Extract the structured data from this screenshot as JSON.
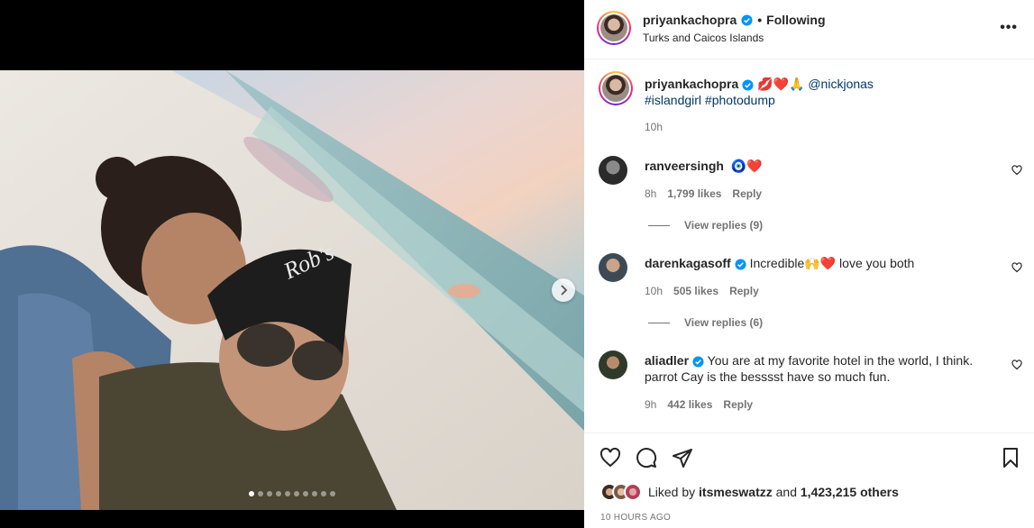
{
  "post": {
    "username": "priyankachopra",
    "follow_separator": "•",
    "follow_status": "Following",
    "location": "Turks and Caicos Islands",
    "more_label": "•••"
  },
  "caption": {
    "username": "priyankachopra",
    "emojis": "💋❤️🙏",
    "mention": "@nickjonas",
    "hashtags": "#islandgirl #photodump",
    "time": "10h"
  },
  "comments": [
    {
      "username": "ranveersingh",
      "text": "🧿❤️",
      "time": "8h",
      "likes": "1,799 likes",
      "reply": "Reply",
      "view_replies": "View replies (9)"
    },
    {
      "username": "darenkagasoff",
      "text": "Incredible🙌❤️ love you both",
      "time": "10h",
      "likes": "505 likes",
      "reply": "Reply",
      "view_replies": "View replies (6)"
    },
    {
      "username": "aliadler",
      "text": "You are at my favorite hotel in the world, I think. parrot Cay is the besssst have so much fun.",
      "time": "9h",
      "likes": "442 likes",
      "reply": "Reply"
    }
  ],
  "likes": {
    "prefix": "Liked by",
    "user": "itsmeswatzz",
    "middle": "and",
    "count": "1,423,215 others"
  },
  "time_ago": "10 HOURS AGO",
  "carousel": {
    "count": 10,
    "active_index": 0
  },
  "icons": {
    "like": "heart-icon",
    "comment": "comment-icon",
    "share": "paper-plane-icon",
    "save": "bookmark-icon",
    "next": "chevron-right-icon",
    "verified": "verified-badge-icon"
  },
  "colors": {
    "verified": "#0095f6",
    "link": "#00376b",
    "muted": "#737373",
    "text": "#262626"
  }
}
